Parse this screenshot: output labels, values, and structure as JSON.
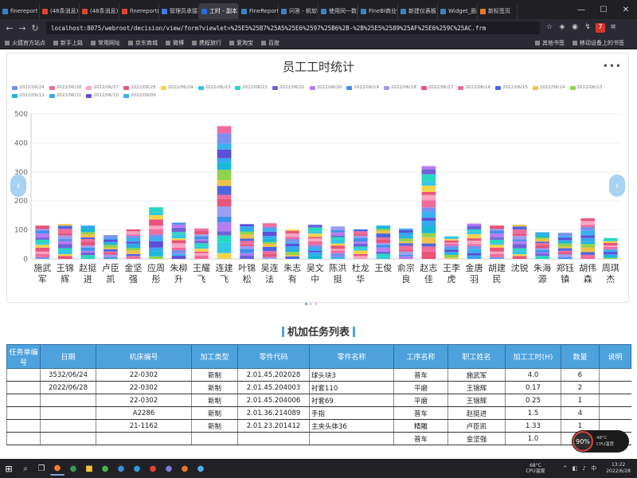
{
  "browser": {
    "tabs": [
      {
        "label": "finereport 初始",
        "color": "#3b82c4"
      },
      {
        "label": "(46条消息) fine",
        "color": "#e0452f"
      },
      {
        "label": "(46条消息) Fin",
        "color": "#e0452f"
      },
      {
        "label": "finereport的从",
        "color": "#e0452f"
      },
      {
        "label": "管理员承接项目",
        "color": "#3c7be0"
      },
      {
        "label": "工时 - 副本",
        "color": "#2a6ad6",
        "active": true
      },
      {
        "label": "FineReport帮助",
        "color": "#3b82c4"
      },
      {
        "label": "问答 - 帆软社区",
        "color": "#3b82c4"
      },
      {
        "label": "使用同一数据",
        "color": "#3b82c4"
      },
      {
        "label": "FineBI商业智能",
        "color": "#3b82c4"
      },
      {
        "label": "新建仪表板1",
        "color": "#3b82c4"
      },
      {
        "label": "Widget_面板控",
        "color": "#3b82c4"
      },
      {
        "label": "新标签页",
        "color": "#e8762b"
      }
    ],
    "url": "localhost:8075/webroot/decision/view/form?viewlet=%25E5%25B7%25A5%25E6%2597%25B6%2B-%2B%25E5%2589%25AF%25E6%259C%25AC.frm",
    "bookmarks": [
      "火狐官方站点",
      "新手上路",
      "常用网址",
      "京东商城",
      "微博",
      "携程旅行",
      "爱淘宝",
      "百度"
    ],
    "bookmarks_right": [
      "其他书签",
      "移动设备上的书签"
    ]
  },
  "chart_data": {
    "type": "bar",
    "stacked": true,
    "title": "员工工时统计",
    "more_label": "•••",
    "ylim": [
      0,
      500
    ],
    "yticks": [
      0,
      100,
      200,
      300,
      400,
      500
    ],
    "categories": [
      "施武军",
      "王锦辉",
      "赵挺进",
      "卢臣凯",
      "金坚强",
      "应周彤",
      "朱柳升",
      "王耀飞",
      "连建飞",
      "叶锦松",
      "吴连法",
      "朱志有",
      "吴文中",
      "陈洪挺",
      "杜龙华",
      "王俊",
      "俞宗良",
      "赵志佳",
      "王李虎",
      "金唐羽",
      "胡建民",
      "沈锐",
      "朱海源",
      "郑钰镇",
      "胡伟森",
      "周琪杰"
    ],
    "totals": [
      115,
      120,
      115,
      82,
      102,
      178,
      125,
      105,
      458,
      120,
      123,
      102,
      118,
      112,
      102,
      115,
      105,
      320,
      78,
      122,
      115,
      118,
      92,
      90,
      140,
      72
    ],
    "series": [
      {
        "name": "2022/06/24",
        "color": "#7b8ff0"
      },
      {
        "name": "2022/06/28",
        "color": "#f06c9b"
      },
      {
        "name": "2022/06/27",
        "color": "#f8a5c2"
      },
      {
        "name": "2022/06/25",
        "color": "#e8547a"
      },
      {
        "name": "2022/06/24",
        "color": "#f3d44a"
      },
      {
        "name": "2022/06/23",
        "color": "#35c7e6"
      },
      {
        "name": "2022/06/22",
        "color": "#28d7c3"
      },
      {
        "name": "2022/06/21",
        "color": "#6e62d8"
      },
      {
        "name": "2022/06/20",
        "color": "#b77bf2"
      },
      {
        "name": "2022/06/19",
        "color": "#3f90ec"
      },
      {
        "name": "2022/06/18",
        "color": "#9d9df2"
      },
      {
        "name": "2022/06/17",
        "color": "#e8547a"
      },
      {
        "name": "2022/06/16",
        "color": "#f06c9b"
      },
      {
        "name": "2022/06/15",
        "color": "#4b66e0"
      },
      {
        "name": "2022/06/14",
        "color": "#f0c24a"
      },
      {
        "name": "2022/06/13",
        "color": "#8fd24f"
      },
      {
        "name": "2022/06/12",
        "color": "#1ab8d8"
      },
      {
        "name": "2022/06/11",
        "color": "#35a7f0"
      },
      {
        "name": "2022/06/10",
        "color": "#5a4fd6"
      },
      {
        "name": "2022/06/09",
        "color": "#3ab0f0"
      }
    ]
  },
  "table": {
    "title": "机加任务列表",
    "headers": [
      "任务单编号",
      "日期",
      "机床编号",
      "加工类型",
      "零件代码",
      "零件名称",
      "工序名称",
      "职工姓名",
      "加工工时(H)",
      "数量",
      "说明"
    ],
    "rows": [
      [
        "",
        "3532/06/24",
        "22-0302",
        "新制",
        "2.01.45.202028",
        "球头块3",
        "普车",
        "施武军",
        "4.0",
        "6",
        ""
      ],
      [
        "",
        "2022/06/28",
        "22-0302",
        "新制",
        "2.01.45.204003",
        "衬套110",
        "平磨",
        "王锦辉",
        "0.17",
        "2",
        ""
      ],
      [
        "",
        "",
        "22-0302",
        "新制",
        "2.01.45.204006",
        "衬套69",
        "平磨",
        "王锦辉",
        "0.25",
        "1",
        ""
      ],
      [
        "",
        "",
        "A2286",
        "新制",
        "2.01.36.214089",
        "手指",
        "普车",
        "赵挺进",
        "1.5",
        "4",
        ""
      ],
      [
        "",
        "",
        "21-1162",
        "新制",
        "2.01.23.201412",
        "主夹头体36",
        "精雕",
        "卢臣凯",
        "1.33",
        "1",
        ""
      ],
      [
        "",
        "",
        "",
        "",
        "",
        "",
        "普车",
        "金坚强",
        "1.0",
        "1",
        ""
      ]
    ]
  },
  "cpu": {
    "percent": "90%",
    "temp": "48°C",
    "label": "CPU温度"
  },
  "taskbar": {
    "weather_temp": "68°C",
    "weather_label": "CPU温度",
    "time": "13:22",
    "date": "2022/6/28"
  }
}
